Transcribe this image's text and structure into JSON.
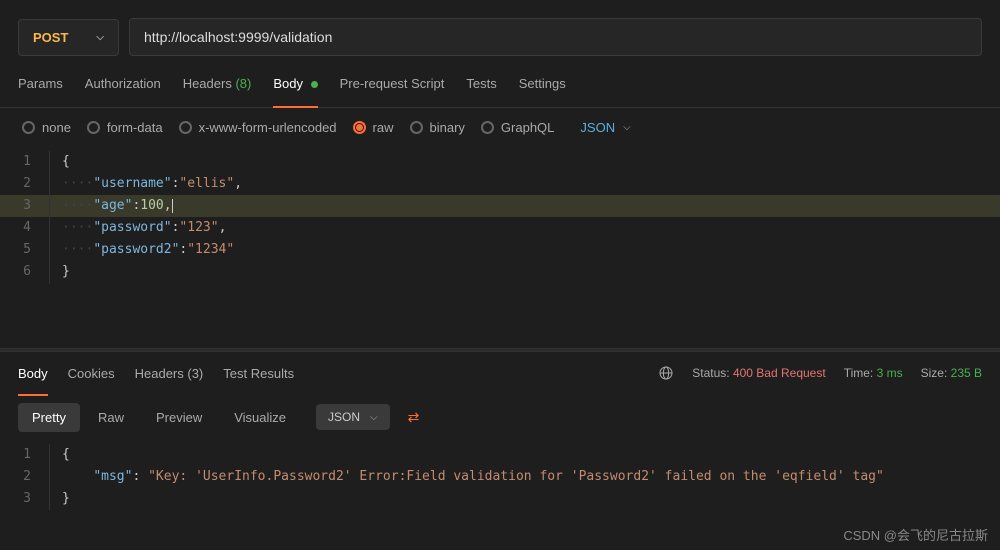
{
  "request": {
    "method": "POST",
    "url": "http://localhost:9999/validation"
  },
  "tabs": {
    "params": "Params",
    "authorization": "Authorization",
    "headers": "Headers",
    "headers_count": "(8)",
    "body": "Body",
    "prerequest": "Pre-request Script",
    "tests": "Tests",
    "settings": "Settings"
  },
  "body_types": {
    "none": "none",
    "formdata": "form-data",
    "urlencoded": "x-www-form-urlencoded",
    "raw": "raw",
    "binary": "binary",
    "graphql": "GraphQL",
    "format": "JSON"
  },
  "request_body": {
    "lines": [
      "1",
      "2",
      "3",
      "4",
      "5",
      "6"
    ],
    "l1": "{",
    "l2_key": "\"username\"",
    "l2_val": "\"ellis\"",
    "l3_key": "\"age\"",
    "l3_val": "100",
    "l4_key": "\"password\"",
    "l4_val": "\"123\"",
    "l5_key": "\"password2\"",
    "l5_val": "\"1234\"",
    "l6": "}"
  },
  "response_tabs": {
    "body": "Body",
    "cookies": "Cookies",
    "headers": "Headers",
    "headers_count": "(3)",
    "test_results": "Test Results"
  },
  "status": {
    "status_label": "Status:",
    "status_code": "400 Bad Request",
    "time_label": "Time:",
    "time_value": "3 ms",
    "size_label": "Size:",
    "size_value": "235 B"
  },
  "view": {
    "pretty": "Pretty",
    "raw": "Raw",
    "preview": "Preview",
    "visualize": "Visualize",
    "format": "JSON"
  },
  "response_body": {
    "lines": [
      "1",
      "2",
      "3"
    ],
    "l1": "{",
    "l2_key": "\"msg\"",
    "l2_val": "\"Key: 'UserInfo.Password2' Error:Field validation for 'Password2' failed on the 'eqfield' tag\"",
    "l3": "}"
  },
  "watermark": "CSDN @会飞的尼古拉斯",
  "bottom_watermark": ""
}
